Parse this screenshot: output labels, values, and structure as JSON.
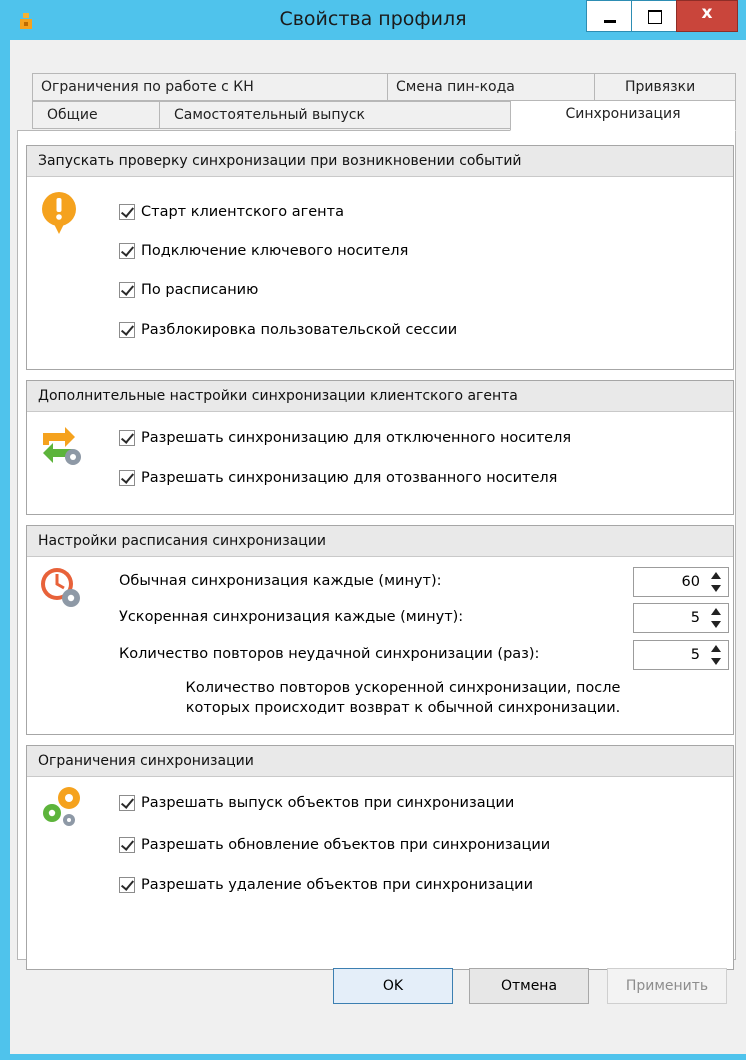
{
  "window": {
    "title": "Свойства профиля",
    "close_glyph": "x"
  },
  "tabs": {
    "row1": [
      {
        "label": "Ограничения по работе с КН"
      },
      {
        "label": "Смена пин-кода"
      },
      {
        "label": "Привязки"
      }
    ],
    "row2": [
      {
        "label": "Общие"
      },
      {
        "label": "Самостоятельный выпуск"
      },
      {
        "label": "Синхронизация"
      }
    ],
    "active": "Синхронизация"
  },
  "group1": {
    "title": "Запускать проверку синхронизации при возникновении событий",
    "icon": "exclamation-balloon-icon",
    "items": [
      {
        "label": "Старт клиентского агента",
        "checked": true
      },
      {
        "label": "Подключение ключевого носителя",
        "checked": true
      },
      {
        "label": "По расписанию",
        "checked": true
      },
      {
        "label": "Разблокировка пользовательской сессии",
        "checked": true
      }
    ]
  },
  "group2": {
    "title": "Дополнительные настройки синхронизации клиентского агента",
    "icon": "sync-arrows-gear-icon",
    "items": [
      {
        "label": "Разрешать синхронизацию для отключенного носителя",
        "checked": true
      },
      {
        "label": "Разрешать синхронизацию для отозванного носителя",
        "checked": true
      }
    ]
  },
  "group3": {
    "title": "Настройки расписания синхронизации",
    "icon": "clock-gear-icon",
    "fields": [
      {
        "label": "Обычная синхронизация каждые (минут):",
        "value": "60"
      },
      {
        "label": "Ускоренная синхронизация каждые (минут):",
        "value": "5"
      },
      {
        "label": "Количество повторов неудачной синхронизации (раз):",
        "value": "5"
      }
    ],
    "note_line1": "Количество повторов ускоренной синхронизации, после",
    "note_line2": "которых происходит возврат к обычной синхронизации."
  },
  "group4": {
    "title": "Ограничения синхронизации",
    "icon": "gears-icon",
    "items": [
      {
        "label": "Разрешать выпуск объектов при синхронизации",
        "checked": true
      },
      {
        "label": "Разрешать обновление объектов при синхронизации",
        "checked": true
      },
      {
        "label": "Разрешать удаление объектов при синхронизации",
        "checked": true
      }
    ]
  },
  "buttons": {
    "ok": "OK",
    "cancel": "Отмена",
    "apply": "Применить"
  },
  "colors": {
    "frame": "#4fc3ec",
    "close": "#c9453b",
    "icon_orange": "#f5a21e",
    "icon_green": "#5db43b"
  }
}
